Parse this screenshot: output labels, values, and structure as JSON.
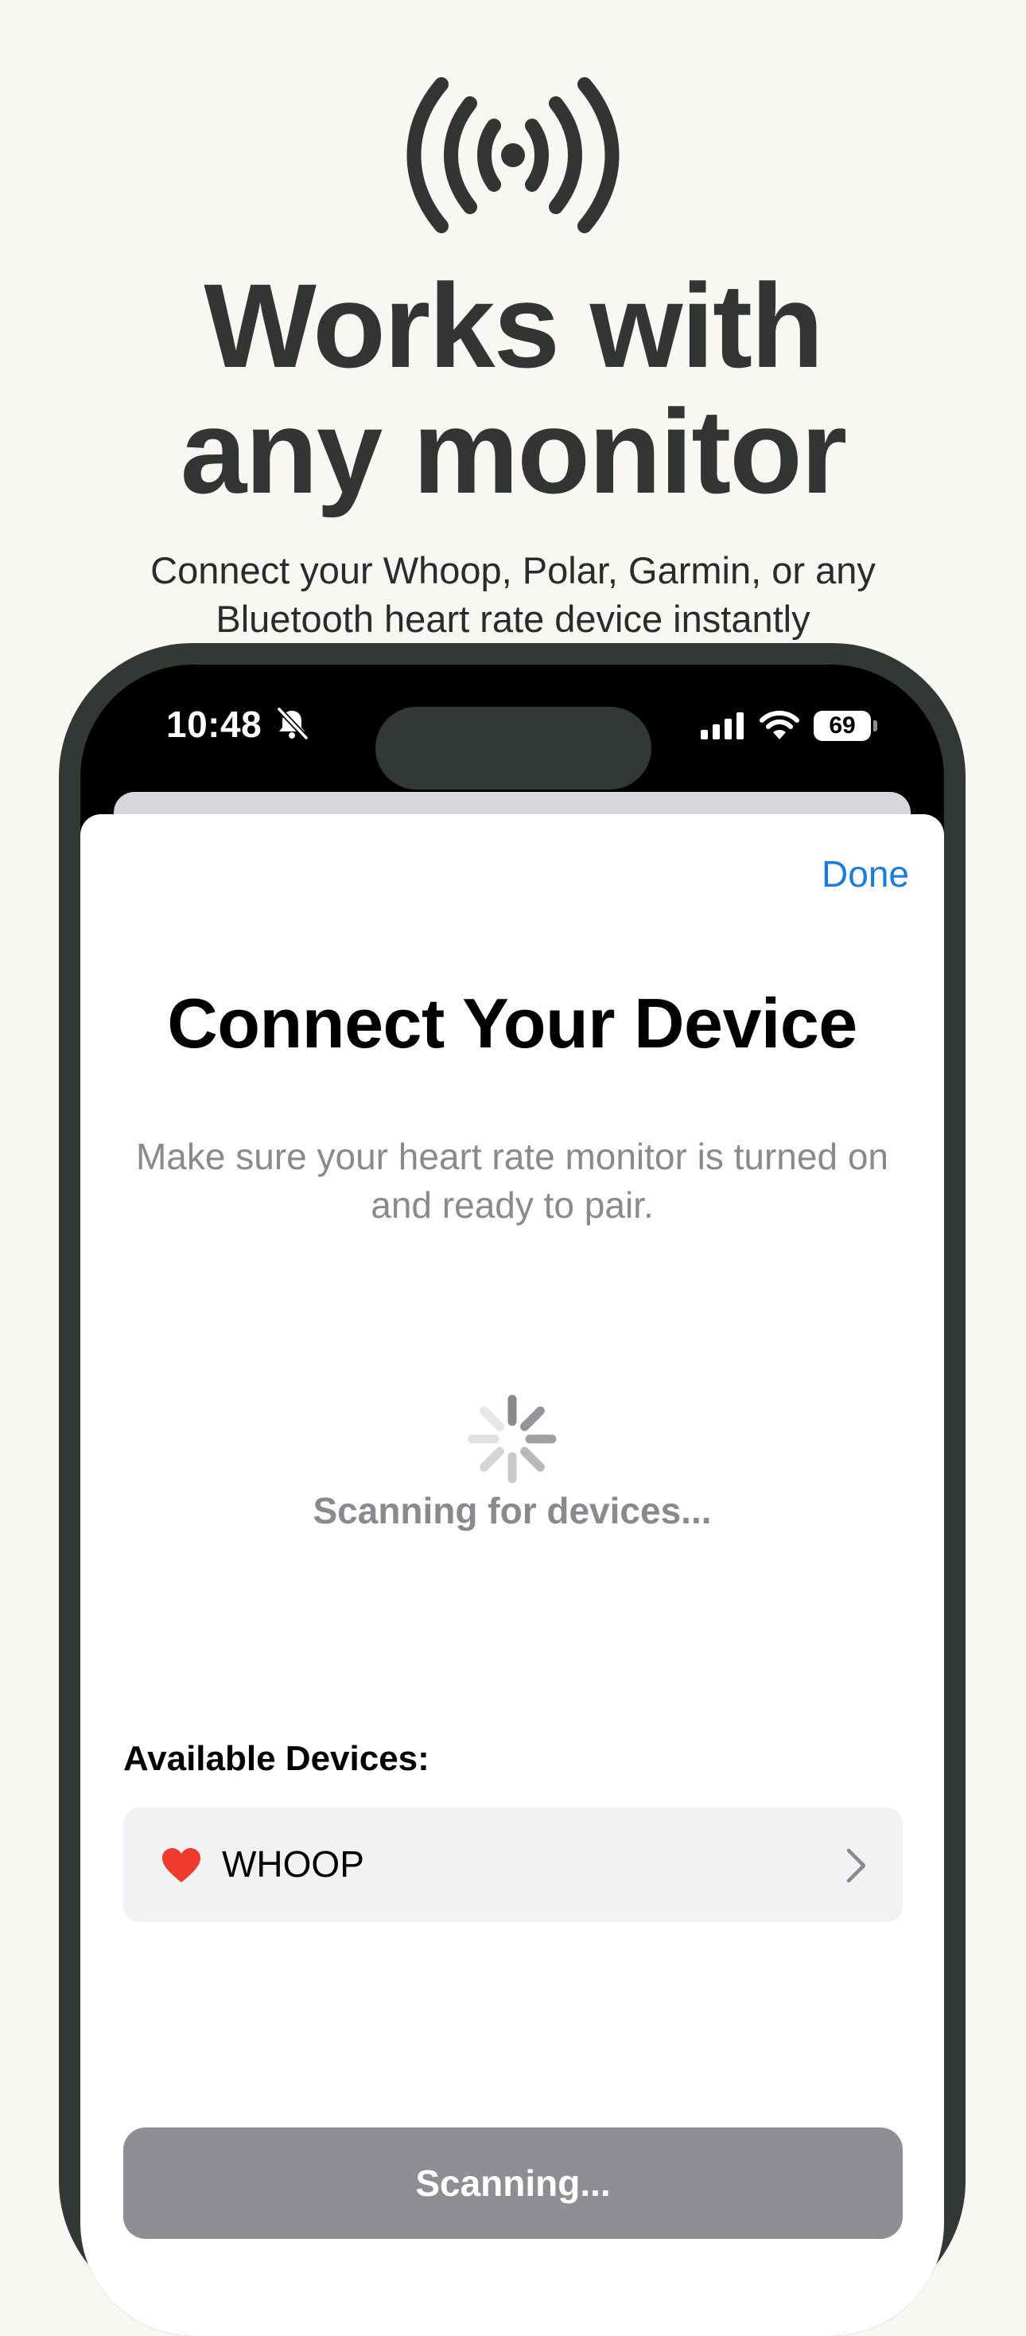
{
  "marketing": {
    "headline_line1": "Works with",
    "headline_line2": "any monitor",
    "subhead_line1": "Connect your Whoop, Polar, Garmin, or any",
    "subhead_line2": "Bluetooth heart rate device instantly",
    "hero_icon": "broadcast-icon"
  },
  "status_bar": {
    "time": "10:48",
    "silent_icon": "bell-slash-icon",
    "battery": "69"
  },
  "sheet": {
    "done_label": "Done",
    "title": "Connect Your Device",
    "description": "Make sure your heart rate monitor is turned on and ready to pair.",
    "scanning_status": "Scanning for devices...",
    "available_label": "Available Devices:",
    "devices": [
      {
        "name": "WHOOP",
        "icon": "heart-icon"
      }
    ],
    "scan_button_label": "Scanning..."
  },
  "colors": {
    "background": "#f8f7f4",
    "frame": "#343835",
    "accent": "#1a7ce0",
    "heart": "#ef3b2d",
    "disabled_button": "#8e8e93"
  }
}
